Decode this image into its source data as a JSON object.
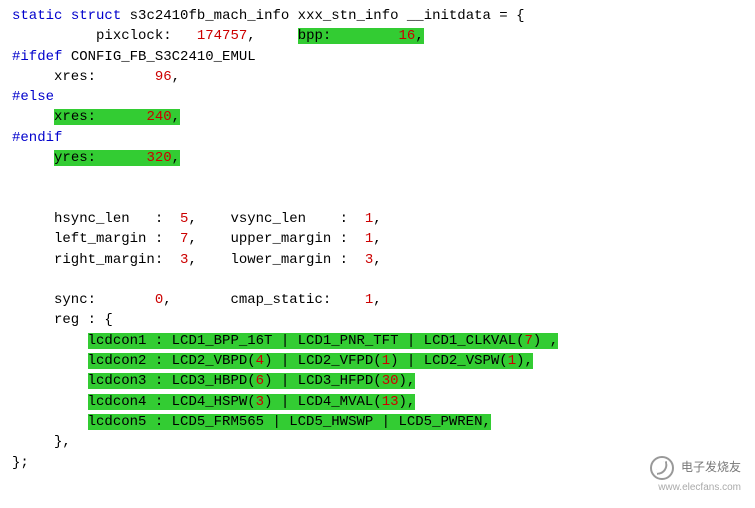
{
  "l1a": "static",
  "l1b": "struct",
  "l1c": " s3c2410fb_mach_info xxx_stn_info __initdata = {",
  "l2a": "          pixclock:   ",
  "l2b": "174757",
  "l2c": ",     ",
  "l2d": "bpp:        ",
  "l2e": "16",
  "l2f": ",",
  "l3a": "#ifdef",
  "l3b": " CONFIG_FB_S3C2410_EMUL",
  "l4a": "     xres:       ",
  "l4b": "96",
  "l4c": ",",
  "l5a": "#else",
  "l6a": "     ",
  "l6b": "xres:      ",
  "l6c": "240",
  "l6d": ",",
  "l7a": "#endif",
  "l8a": "     ",
  "l8b": "yres:      ",
  "l8c": "320",
  "l8d": ",",
  "blank": " ",
  "l10a": "     hsync_len   :  ",
  "l10b": "5",
  "l10c": ",    vsync_len    :  ",
  "l10d": "1",
  "l10e": ",",
  "l11a": "     left_margin :  ",
  "l11b": "7",
  "l11c": ",    upper_margin :  ",
  "l11d": "1",
  "l11e": ",",
  "l12a": "     right_margin:  ",
  "l12b": "3",
  "l12c": ",    lower_margin :  ",
  "l12d": "3",
  "l12e": ",",
  "l14a": "     sync:       ",
  "l14b": "0",
  "l14c": ",       cmap_static:    ",
  "l14d": "1",
  "l14e": ",",
  "l15a": "     reg : {",
  "r1a": "         ",
  "r1b": "lcdcon1 : LCD1_BPP_16T | LCD1_PNR_TFT | LCD1_CLKVAL(",
  "r1c": "7",
  "r1d": ") ,",
  "r2a": "         ",
  "r2b": "lcdcon2 : LCD2_VBPD(",
  "r2c": "4",
  "r2d": ") | LCD2_VFPD(",
  "r2e": "1",
  "r2f": ") | LCD2_VSPW(",
  "r2g": "1",
  "r2h": "),",
  "r3a": "         ",
  "r3b": "lcdcon3 : LCD3_HBPD(",
  "r3c": "6",
  "r3d": ") | LCD3_HFPD(",
  "r3e": "30",
  "r3f": "),",
  "r4a": "         ",
  "r4b": "lcdcon4 : LCD4_HSPW(",
  "r4c": "3",
  "r4d": ") | LCD4_MVAL(",
  "r4e": "13",
  "r4f": "),",
  "r5a": "         ",
  "r5b": "lcdcon5 : LCD5_FRM565 | LCD5_HWSWP | LCD5_PWREN,",
  "l21a": "     },",
  "l22a": "};",
  "wm_cn": "电子发烧友",
  "wm_url": "www.elecfans.com"
}
